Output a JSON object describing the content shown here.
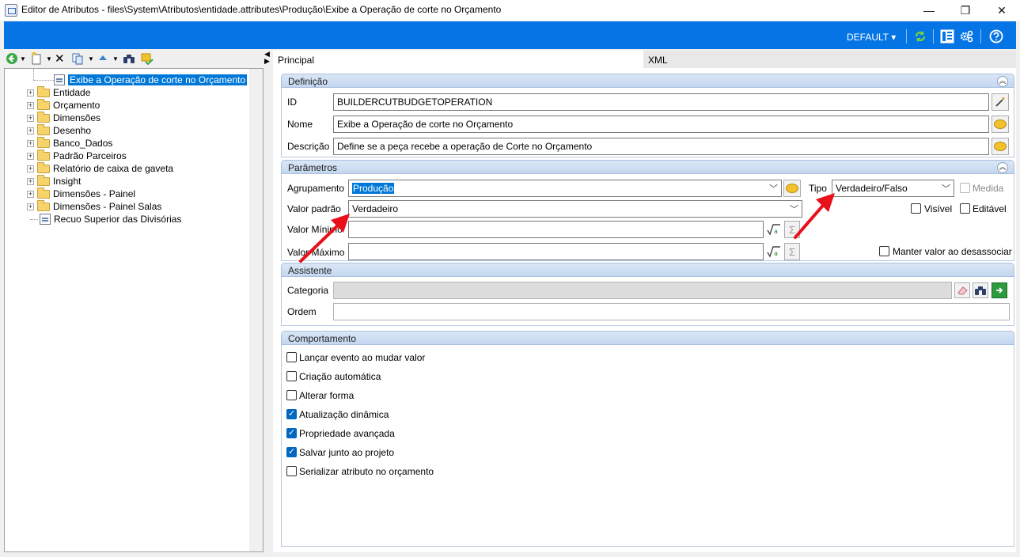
{
  "window": {
    "title": "Editor de Atributos - files\\System\\Atributos\\entidade.attributes\\Produção\\Exibe a Operação de corte no Orçamento",
    "minimize": "—",
    "maximize": "❐",
    "close": "✕"
  },
  "ribbon": {
    "profile": "DEFAULT ▾"
  },
  "tree": {
    "selected_item": "Exibe a Operação de corte no Orçamento",
    "folders": [
      "Entidade",
      "Orçamento",
      "Dimensões",
      "Desenho",
      "Banco_Dados",
      "Padrão Parceiros",
      "Relatório de caixa de gaveta",
      "Insight",
      "Dimensões - Painel",
      "Dimensões - Painel Salas"
    ],
    "last_item": "Recuo Superior das Divisórias"
  },
  "tabs": {
    "principal": "Principal",
    "xml": "XML"
  },
  "definicao": {
    "header": "Definição",
    "id_label": "ID",
    "id_value": "BUILDERCUTBUDGETOPERATION",
    "nome_label": "Nome",
    "nome_value": "Exibe a Operação de corte no Orçamento",
    "descricao_label": "Descrição",
    "descricao_value": "Define se a peça recebe a operação de Corte no Orçamento"
  },
  "parametros": {
    "header": "Parâmetros",
    "agrupamento_label": "Agrupamento",
    "agrupamento_value": "Produção",
    "tipo_label": "Tipo",
    "tipo_value": "Verdadeiro/Falso",
    "medida_label": "Medida",
    "valor_padrao_label": "Valor padrão",
    "valor_padrao_value": "Verdadeiro",
    "visivel_label": "Visível",
    "editavel_label": "Editável",
    "valor_minimo_label": "Valor Mínimo",
    "valor_maximo_label": "Valor Máximo",
    "manter_label": "Manter valor ao desassociar"
  },
  "assistente": {
    "header": "Assistente",
    "categoria_label": "Categoria",
    "ordem_label": "Ordem"
  },
  "comportamento": {
    "header": "Comportamento",
    "options": [
      {
        "label": "Lançar evento ao mudar valor",
        "checked": false
      },
      {
        "label": "Criação automática",
        "checked": false
      },
      {
        "label": "Alterar forma",
        "checked": false
      },
      {
        "label": "Atualização dinâmica",
        "checked": true
      },
      {
        "label": "Propriedade avançada",
        "checked": true
      },
      {
        "label": "Salvar junto ao projeto",
        "checked": true
      },
      {
        "label": "Serializar atributo no orçamento",
        "checked": false
      }
    ]
  },
  "colors": {
    "ribbon": "#0575e6",
    "selection": "#0078d7",
    "annotation": "#e8101b"
  }
}
